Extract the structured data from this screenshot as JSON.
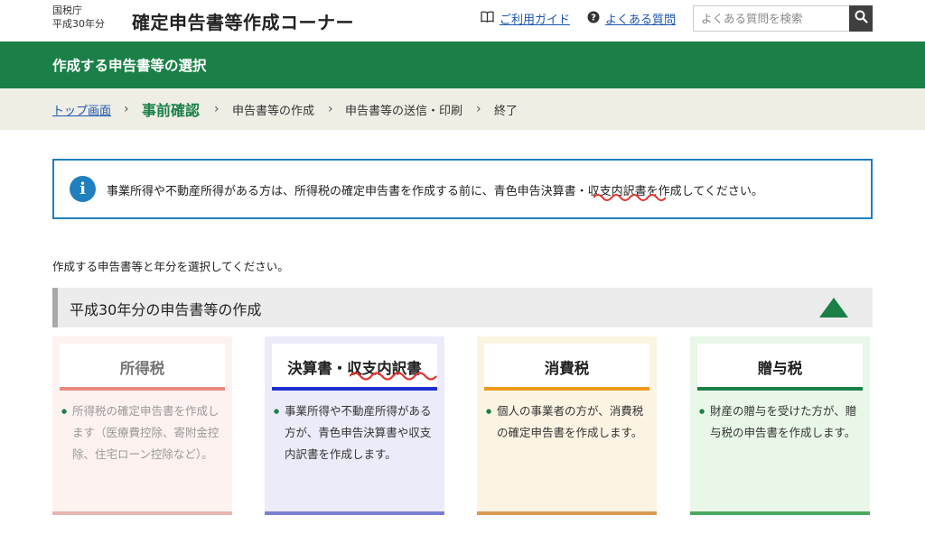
{
  "header": {
    "agency": "国税庁",
    "year_label": "平成30年分",
    "site_title": "確定申告書等作成コーナー",
    "guide_link": "ご利用ガイド",
    "faq_link": "よくある質問",
    "search_placeholder": "よくある質問を検索"
  },
  "page_heading": "作成する申告書等の選択",
  "breadcrumb": {
    "top": "トップ画面",
    "current": "事前確認",
    "step3": "申告書等の作成",
    "step4": "申告書等の送信・印刷",
    "step5": "終了"
  },
  "notice": {
    "message": "事業所得や不動産所得がある方は、所得税の確定申告書を作成する前に、青色申告決算書・収支内訳書を作成してください。"
  },
  "instruction": "作成する申告書等と年分を選択してください。",
  "section": {
    "title": "平成30年分の申告書等の作成"
  },
  "cards": [
    {
      "title": "所得税",
      "desc": "所得税の確定申告書を作成します（医療費控除、寄附金控除、住宅ローン控除など）。",
      "bg": "#fdf2f0",
      "title_color": "#777777",
      "desc_color": "#999999",
      "accent": "#e98a80",
      "foot": "#e8b5ae"
    },
    {
      "title": "決算書・収支内訳書",
      "desc": "事業所得や不動産所得がある方が、青色申告決算書や収支内訳書を作成します。",
      "bg": "#ebebf9",
      "title_color": "#222222",
      "desc_color": "#333333",
      "accent": "#1f2fd0",
      "foot": "#7b7fd0"
    },
    {
      "title": "消費税",
      "desc": "個人の事業者の方が、消費税の確定申告書を作成します。",
      "bg": "#fcf4e3",
      "title_color": "#222222",
      "desc_color": "#333333",
      "accent": "#ef9a1b",
      "foot": "#d99a55"
    },
    {
      "title": "贈与税",
      "desc": "財産の贈与を受けた方が、贈与税の申告書を作成します。",
      "bg": "#e8f7e8",
      "title_color": "#222222",
      "desc_color": "#333333",
      "accent": "#1a8047",
      "foot": "#4aa860"
    }
  ],
  "colors": {
    "brand_green": "#1a8047",
    "link_blue": "#1a56b0",
    "info_blue": "#1f7fbf"
  },
  "icons": {
    "guide": "book-icon",
    "faq": "question-circle-icon",
    "search": "search-icon",
    "info": "info-icon",
    "collapse": "triangle-up-icon"
  }
}
